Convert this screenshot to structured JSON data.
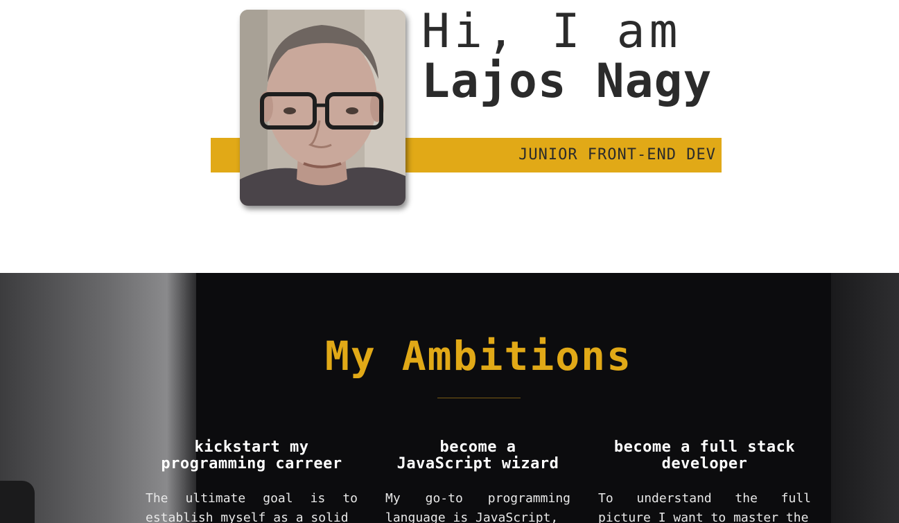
{
  "hero": {
    "greeting": "Hi, I am",
    "name": "Lajos Nagy",
    "role": "JUNIOR FRONT-END DEV",
    "accent_color": "#e1a917"
  },
  "ambitions": {
    "title": "My Ambitions",
    "title_color": "#e1a917",
    "items": [
      {
        "title": "kickstart my programming carreer",
        "text": "The ultimate goal is to establish myself as a solid"
      },
      {
        "title": "become a JavaScript wizard",
        "text": "My go-to programming language is JavaScript,"
      },
      {
        "title": "become a full stack developer",
        "text": "To understand the full picture I want to master the"
      }
    ]
  }
}
